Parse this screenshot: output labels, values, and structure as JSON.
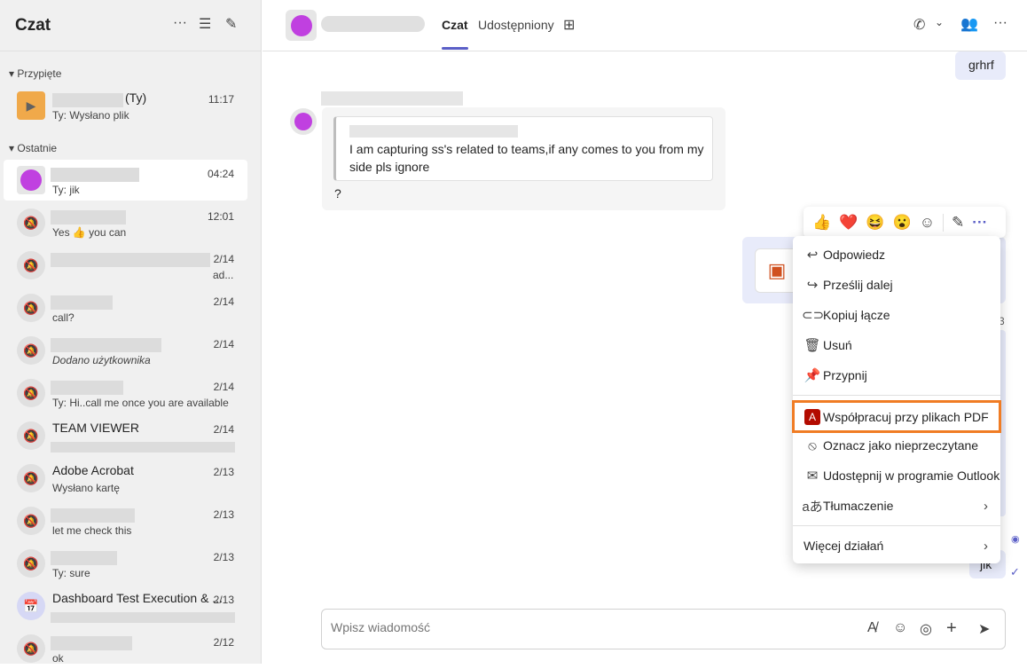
{
  "sidebar": {
    "title": "Czat",
    "pinned_label": "Przypięte",
    "recent_label": "Ostatnie",
    "pinned": [
      {
        "name_suffix": "(Ty)",
        "preview": "Ty: Wysłano plik",
        "time": "11:17"
      }
    ],
    "recent": [
      {
        "name": "",
        "preview": "Ty: jik",
        "time": "04:24"
      },
      {
        "name": "",
        "preview": "Yes 👍 you can",
        "time": "12:01"
      },
      {
        "name": "",
        "preview": "ad...",
        "time": "2/14"
      },
      {
        "name": "",
        "preview": "call?",
        "time": "2/14"
      },
      {
        "name": "",
        "preview": "Dodano użytkownika",
        "time": "2/14"
      },
      {
        "name": "",
        "preview": "Ty: Hi..call me once you are available",
        "time": "2/14"
      },
      {
        "name": "TEAM VIEWER",
        "preview": "",
        "time": "2/14"
      },
      {
        "name": "Adobe Acrobat",
        "preview": "Wysłano kartę",
        "time": "2/13"
      },
      {
        "name": "",
        "preview": "let me check this",
        "time": "2/13"
      },
      {
        "name": "",
        "preview": "Ty: sure",
        "time": "2/13"
      },
      {
        "name": "Dashboard Test Execution & ...",
        "preview": "",
        "time": "2/13"
      },
      {
        "name": "",
        "preview": "ok",
        "time": "2/12"
      }
    ]
  },
  "header": {
    "tabs": [
      "Czat",
      "Udostępniony"
    ]
  },
  "messages": {
    "own_top": "grhrf",
    "quote": "I am capturing ss's related to teams,if any comes to you from my side pls ignore",
    "reply": "?",
    "own_bottom": "jik",
    "partial_time": "3"
  },
  "reactions": [
    "👍",
    "❤️",
    "😆",
    "😮"
  ],
  "menu": {
    "items": [
      "Odpowiedz",
      "Prześlij dalej",
      "Kopiuj łącze",
      "Usuń",
      "Przypnij",
      "Współpracuj przy plikach PDF",
      "Oznacz jako nieprzeczytane",
      "Udostępnij w programie Outlook",
      "Tłumaczenie",
      "Więcej działań"
    ]
  },
  "compose": {
    "placeholder": "Wpisz wiadomość"
  },
  "colors": {
    "accent": "#5b5fc7",
    "highlight": "#f07c24",
    "pdf": "#b30b00"
  }
}
